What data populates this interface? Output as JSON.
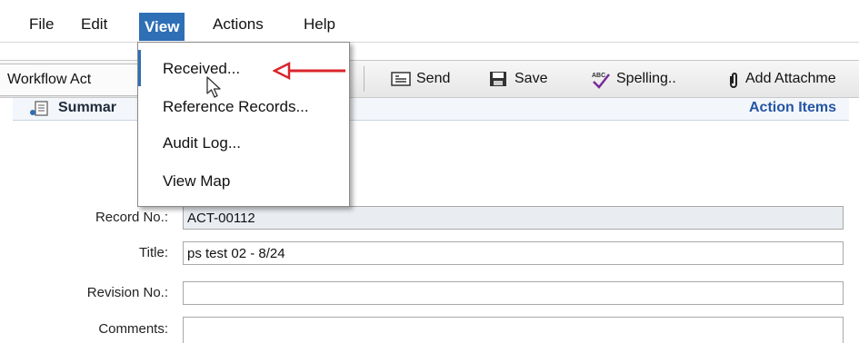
{
  "menubar": {
    "items": [
      "File",
      "Edit",
      "View",
      "Actions",
      "Help"
    ],
    "active": "View"
  },
  "toolbar": {
    "workflow_label": "Workflow Act",
    "send_label": "Send",
    "save_label": "Save",
    "spelling_label": "Spelling..",
    "attach_label": "Add Attachme"
  },
  "view_menu": {
    "items": [
      "Received...",
      "Reference Records...",
      "Audit Log...",
      "View Map"
    ]
  },
  "section": {
    "title": "Summar",
    "action_items": "Action Items"
  },
  "form": {
    "record_no_label": "Record No.:",
    "record_no_value": "ACT-00112",
    "title_label": "Title:",
    "title_value": "ps test 02 - 8/24",
    "revision_label": "Revision No.:",
    "revision_value": "",
    "comments_label": "Comments:",
    "comments_value": ""
  },
  "colors": {
    "menu_active_bg": "#2e6fb6",
    "annotation_arrow": "#d9262b",
    "action_items_text": "#2456a4"
  },
  "icons": [
    "send-icon",
    "save-icon",
    "spelling-icon",
    "paperclip-icon",
    "summary-icon",
    "mouse-cursor-icon",
    "red-arrow-icon"
  ]
}
